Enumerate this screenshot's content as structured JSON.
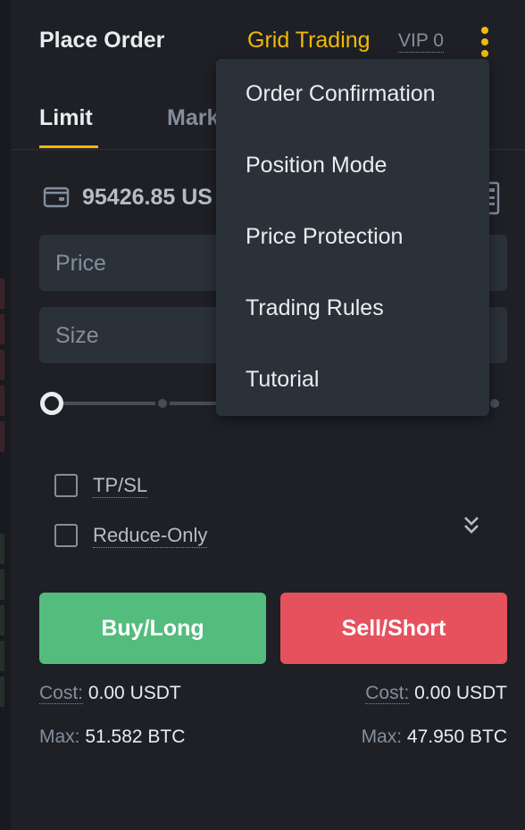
{
  "header": {
    "title": "Place Order",
    "grid_trading": "Grid Trading",
    "vip": "VIP 0"
  },
  "tabs": {
    "limit": "Limit",
    "market": "Mark"
  },
  "balance": {
    "value": "95426.85 US"
  },
  "fields": {
    "price_placeholder": "Price",
    "size_placeholder": "Size"
  },
  "slider": {
    "value_percent": 0
  },
  "options": {
    "tpsl": "TP/SL",
    "reduce_only": "Reduce-Only"
  },
  "buttons": {
    "buy": "Buy/Long",
    "sell": "Sell/Short"
  },
  "buy_info": {
    "cost_label": "Cost:",
    "cost_value": "0.00 USDT",
    "max_label": "Max:",
    "max_value": "51.582 BTC"
  },
  "sell_info": {
    "cost_label": "Cost:",
    "cost_value": "0.00 USDT",
    "max_label": "Max:",
    "max_value": "47.950 BTC"
  },
  "menu": {
    "items": [
      "Order Confirmation",
      "Position Mode",
      "Price Protection",
      "Trading Rules",
      "Tutorial"
    ]
  },
  "colors": {
    "accent": "#f0b90b",
    "buy": "#54bc7d",
    "sell": "#e5525e",
    "background": "#1e2026",
    "input": "#2b3139"
  },
  "icons": [
    "wallet-icon",
    "calculator-icon",
    "kebab-menu-icon",
    "chevron-down-icon",
    "double-chevron-down-icon"
  ]
}
